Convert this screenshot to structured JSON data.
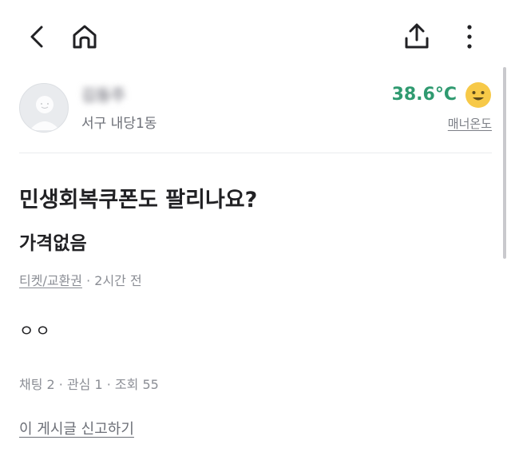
{
  "seller": {
    "nickname": "김동주",
    "region": "서구 내당1동",
    "temperature": "38.6°C",
    "temperature_label": "매너온도",
    "temperature_color": "#2f9a70"
  },
  "post": {
    "title": "민생회복쿠폰도 팔리나요?",
    "price": "가격없음",
    "category": "티켓/교환권",
    "time": "· 2시간 전",
    "description": "ㅇㅇ",
    "stats": "채팅 2 · 관심 1 · 조회 55"
  },
  "footer": {
    "report_label": "이 게시글 신고하기"
  },
  "icons": {
    "back": "chevron-left-icon",
    "home": "home-icon",
    "share": "share-icon",
    "more": "more-vertical-icon",
    "temperature_face": "smile-emoji-icon"
  }
}
